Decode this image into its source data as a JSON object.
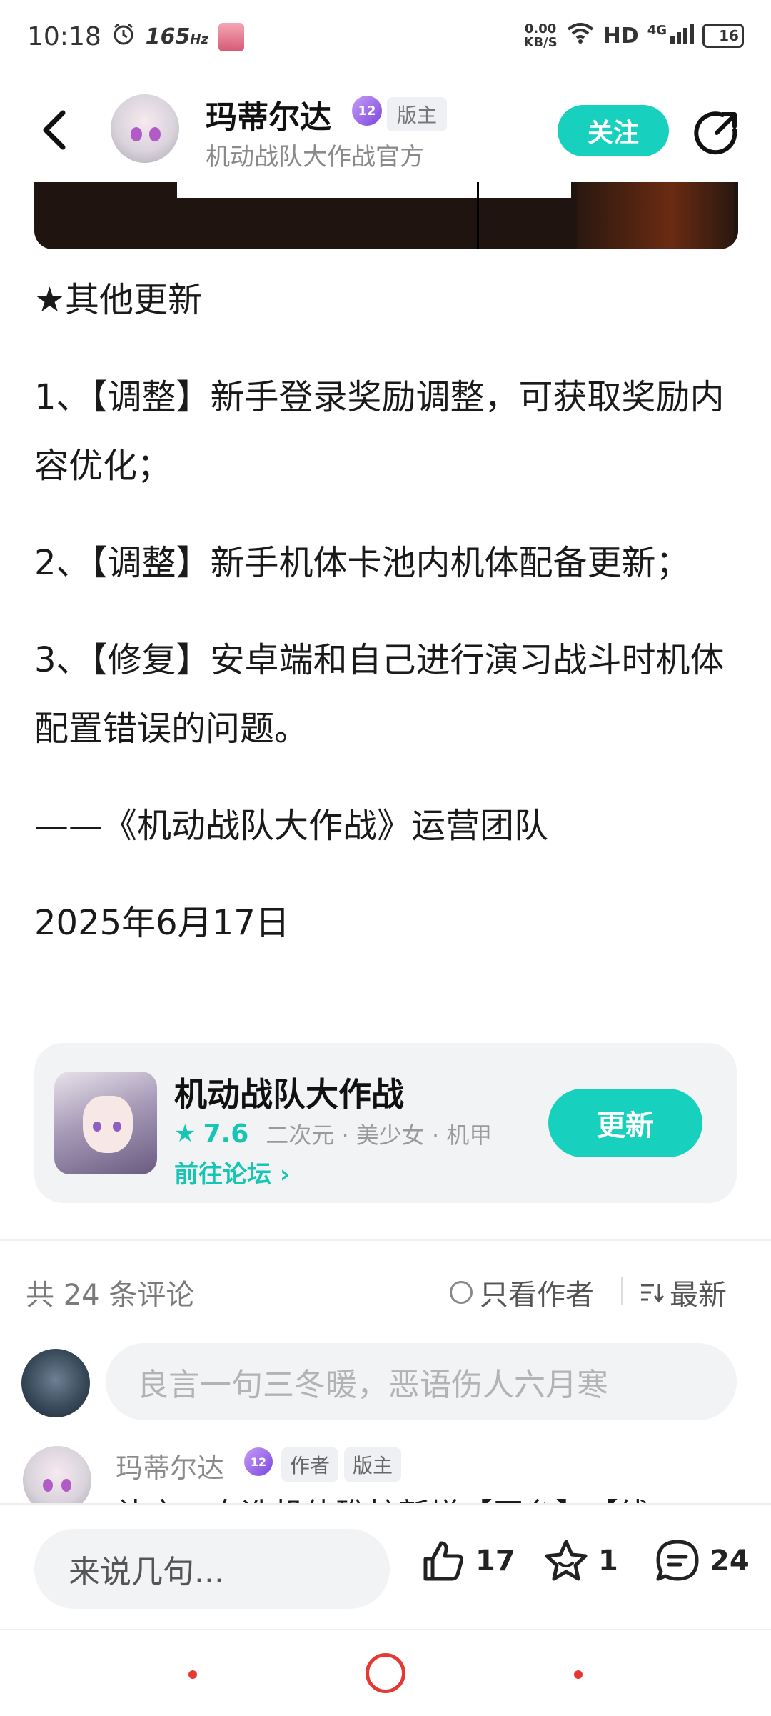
{
  "status_bar": {
    "time": "10:18",
    "refresh_rate": "165",
    "refresh_unit": "Hz",
    "net_speed_value": "0.00",
    "net_speed_unit": "KB/S",
    "hd": "HD",
    "network": "4G",
    "battery": "16"
  },
  "header": {
    "author_name": "玛蒂尔达",
    "level": "12",
    "role_tag": "版主",
    "subtitle": "机动战队大作战官方",
    "follow_label": "关注"
  },
  "article": {
    "section_title": "★其他更新",
    "items": [
      "1、【调整】新手登录奖励调整，可获取奖励内容优化；",
      "2、【调整】新手机体卡池内机体配备更新；",
      "3、【修复】安卓端和自己进行演习战斗时机体配置错误的问题。"
    ],
    "signature": "——《机动战队大作战》运营团队",
    "date": "2025年6月17日"
  },
  "game_card": {
    "title": "机动战队大作战",
    "rating": "7.6",
    "tags": "二次元 · 美少女 · 机甲",
    "forum_link": "前往论坛 ›",
    "update_label": "更新"
  },
  "comments": {
    "count_label": "共 24 条评论",
    "author_only_label": "只看作者",
    "sort_label": "最新",
    "input_placeholder": "良言一句三冬暖，恶语伤人六月寒",
    "first": {
      "name": "玛蒂尔达",
      "level": "12",
      "tag_author": "作者",
      "tag_mod": "版主",
      "text_partial": "补充：自选机体礁柱新增【田台】、【线"
    }
  },
  "action_bar": {
    "say_placeholder": "来说几句...",
    "likes": "17",
    "favorites": "1",
    "comments": "24"
  },
  "colors": {
    "accent": "#17d1be",
    "accent_text": "#17c6b2",
    "badge": "#8a55e8",
    "nav_red": "#e53935"
  },
  "icons": [
    "back-arrow-icon",
    "share-icon",
    "alarm-icon",
    "wifi-icon",
    "signal-icon",
    "battery-icon",
    "star-icon",
    "radio-icon",
    "sort-icon",
    "like-icon",
    "favorite-icon",
    "comment-icon"
  ]
}
